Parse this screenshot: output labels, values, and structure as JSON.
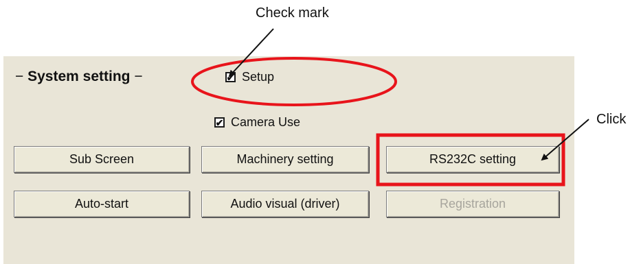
{
  "annotations": {
    "check_mark_label": "Check mark",
    "click_label": "Click",
    "highlight_color": "#e8141b",
    "arrow_color": "#111111"
  },
  "system_setting": {
    "title": "System setting",
    "dash": "−",
    "checkboxes": [
      {
        "label": "Setup",
        "checked": true
      },
      {
        "label": "Camera Use",
        "checked": true
      }
    ],
    "buttons": [
      {
        "label": "Sub Screen",
        "enabled": true
      },
      {
        "label": "Machinery setting",
        "enabled": true
      },
      {
        "label": "RS232C setting",
        "enabled": true
      },
      {
        "label": "Auto-start",
        "enabled": true
      },
      {
        "label": "Audio visual (driver)",
        "enabled": true
      },
      {
        "label": "Registration",
        "enabled": false
      }
    ],
    "check_glyph": "✔"
  }
}
